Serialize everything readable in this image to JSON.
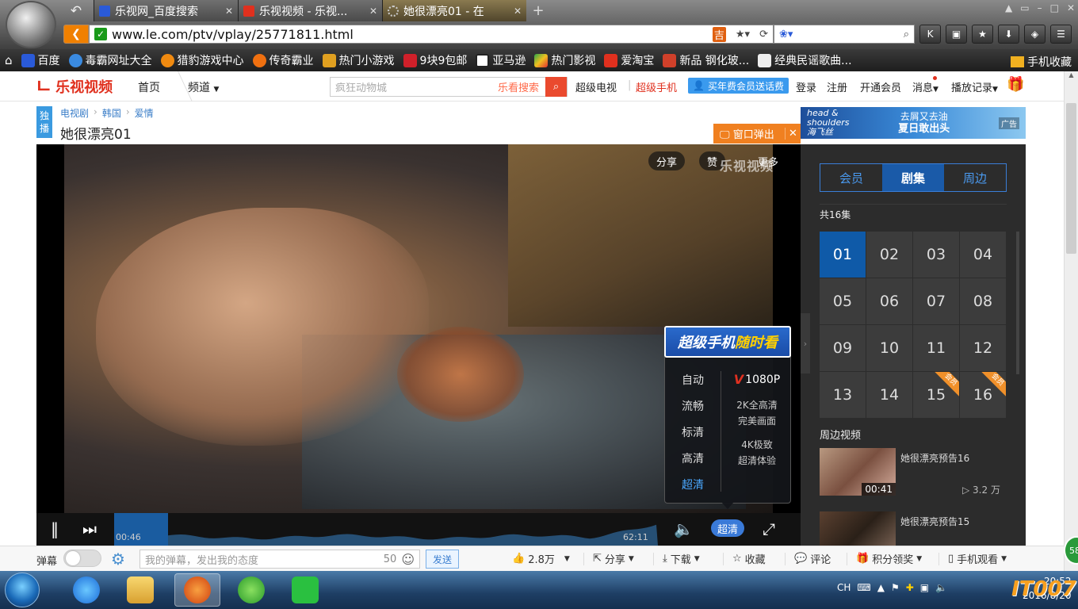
{
  "browser": {
    "tabs": [
      {
        "title": "乐视网_百度搜索",
        "active": false
      },
      {
        "title": "乐视视频 - 乐视...",
        "active": false
      },
      {
        "title": "她很漂亮01 - 在",
        "active": true
      }
    ],
    "url": "www.le.com/ptv/vplay/25771811.html",
    "search_icon": "search-icon",
    "toolbar_icons": [
      "k-icon",
      "lock-icon",
      "star-icon",
      "download-icon",
      "gamepad-icon",
      "menu-icon"
    ]
  },
  "bookmarks": {
    "items": [
      {
        "label": "百度",
        "color": "#2a5ad8"
      },
      {
        "label": "毒霸网址大全",
        "color": "#3a8ae0"
      },
      {
        "label": "猎豹游戏中心",
        "color": "#f08a10"
      },
      {
        "label": "传奇霸业",
        "color": "#f07010"
      },
      {
        "label": "热门小游戏",
        "color": "#e0a020"
      },
      {
        "label": "9块9包邮",
        "color": "#d0202a"
      },
      {
        "label": "亚马逊",
        "color": "#222222"
      },
      {
        "label": "热门影视",
        "color": "#2aa84a"
      },
      {
        "label": "爱淘宝",
        "color": "#e0301e"
      },
      {
        "label": "新品 钢化玻...",
        "color": "#d0402a"
      },
      {
        "label": "经典民谣歌曲...",
        "color": "#dddddd"
      }
    ],
    "right_label": "手机收藏"
  },
  "site": {
    "logo_text": "乐视视频",
    "nav_home": "首页",
    "nav_channel": "频道",
    "search_placeholder": "疯狂动物城",
    "search_button_label": "乐看搜索",
    "link_super_tv": "超级电视",
    "link_super_phone": "超级手机",
    "vip_promo": "买年费会员送话费",
    "login": "登录",
    "register": "注册",
    "open_vip": "开通会员",
    "messages": "消息",
    "history": "播放记录"
  },
  "crumb": {
    "exclusive_1": "独",
    "exclusive_2": "播",
    "links": [
      "电视剧",
      "韩国",
      "爱情"
    ],
    "title": "她很漂亮01"
  },
  "popout": {
    "label": "窗口弹出",
    "close": "✕"
  },
  "ad": {
    "brand_line1": "head &",
    "brand_line2": "shoulders",
    "brand_line3": "海飞丝",
    "slogan_1": "去屑又去油",
    "slogan_2": "夏日敢出头",
    "tag": "广告"
  },
  "player": {
    "pill_share": "分享",
    "pill_like": "赞",
    "pill_more": "更多",
    "watermark": "乐视视频",
    "time_current": "00:46",
    "time_total": "62:11",
    "progress_fraction": 0.0124,
    "quality_button": "超清",
    "quality_popup": {
      "header_white": "超级手机",
      "header_yellow": "随时看",
      "options": [
        "自动",
        "流畅",
        "标清",
        "高清",
        "超清"
      ],
      "selected": "超清",
      "right_1080": "1080P",
      "right_2k_1": "2K全高清",
      "right_2k_2": "完美画面",
      "right_4k_1": "4K极致",
      "right_4k_2": "超清体验"
    }
  },
  "sidebar": {
    "tabs": [
      {
        "label": "会员",
        "active": false
      },
      {
        "label": "剧集",
        "active": true
      },
      {
        "label": "周边",
        "active": false
      }
    ],
    "episode_count": "共16集",
    "episodes": [
      {
        "n": "01",
        "cur": true,
        "vip": false
      },
      {
        "n": "02",
        "cur": false,
        "vip": false
      },
      {
        "n": "03",
        "cur": false,
        "vip": false
      },
      {
        "n": "04",
        "cur": false,
        "vip": false
      },
      {
        "n": "05",
        "cur": false,
        "vip": false
      },
      {
        "n": "06",
        "cur": false,
        "vip": false
      },
      {
        "n": "07",
        "cur": false,
        "vip": false
      },
      {
        "n": "08",
        "cur": false,
        "vip": false
      },
      {
        "n": "09",
        "cur": false,
        "vip": false
      },
      {
        "n": "10",
        "cur": false,
        "vip": false
      },
      {
        "n": "11",
        "cur": false,
        "vip": false
      },
      {
        "n": "12",
        "cur": false,
        "vip": false
      },
      {
        "n": "13",
        "cur": false,
        "vip": false
      },
      {
        "n": "14",
        "cur": false,
        "vip": false
      },
      {
        "n": "15",
        "cur": false,
        "vip": true
      },
      {
        "n": "16",
        "cur": false,
        "vip": true
      }
    ],
    "vip_corner": "会员",
    "related_title": "周边视频",
    "related": [
      {
        "title": "她很漂亮预告16",
        "duration": "00:41",
        "views": "▷ 3.2 万"
      },
      {
        "title": "她很漂亮预告15",
        "duration": "",
        "views": ""
      }
    ]
  },
  "bottombar": {
    "danmu_label": "弹幕",
    "danmu_placeholder": "我的弹幕，发出我的态度",
    "danmu_count": "50",
    "send": "发送",
    "likes": "2.8万",
    "share": "分享",
    "download": "下载",
    "favorite": "收藏",
    "comment": "评论",
    "points": "积分领奖",
    "mobile": "手机观看"
  },
  "taskbar": {
    "tray_lang": "CH",
    "clock_time": "20:52",
    "clock_date": "2016/8/20"
  },
  "overlay": {
    "watermark": "IT007",
    "bubble": "58"
  }
}
